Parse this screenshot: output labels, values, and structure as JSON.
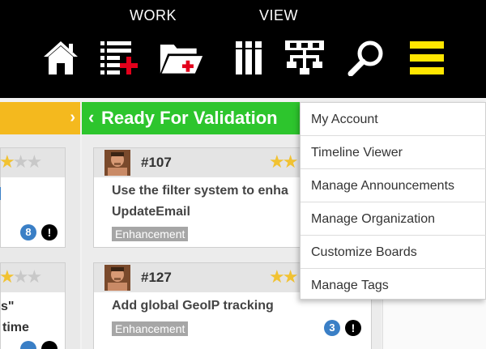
{
  "toolbar": {
    "sections": {
      "work": "WORK",
      "view": "VIEW"
    },
    "tools": [
      {
        "name": "home",
        "icon": "home-icon"
      },
      {
        "name": "add-card",
        "icon": "list-add-icon"
      },
      {
        "name": "add-folder",
        "icon": "folder-add-icon"
      },
      {
        "name": "columns-view",
        "icon": "columns-icon"
      },
      {
        "name": "hierarchy-view",
        "icon": "hierarchy-icon"
      },
      {
        "name": "search",
        "icon": "search-icon"
      },
      {
        "name": "menu",
        "icon": "hamburger-menu-icon"
      }
    ],
    "accent_color": "#ffe600",
    "add_color": "#e3001b"
  },
  "board": {
    "left_column": {
      "chevron": "›",
      "color": "#f4b91e"
    },
    "middle_column": {
      "chevron": "‹",
      "title": "Ready For Validation",
      "color": "#2dc52d"
    },
    "left_fragments": {
      "quote": "s\"",
      "time": "time",
      "count": "8",
      "alert": "!"
    },
    "cards": [
      {
        "id": "#107",
        "line1": "Use the filter system to enha",
        "line2": "UpdateEmail",
        "tag": "Enhancement",
        "count": null,
        "alert": null
      },
      {
        "id": "#127",
        "line1": "Add global GeoIP tracking",
        "line2": "",
        "tag": "Enhancement",
        "count": "3",
        "alert": "!"
      }
    ]
  },
  "dropdown": {
    "items": [
      "My Account",
      "Timeline Viewer",
      "Manage Announcements",
      "Manage Organization",
      "Customize Boards",
      "Manage Tags"
    ]
  }
}
